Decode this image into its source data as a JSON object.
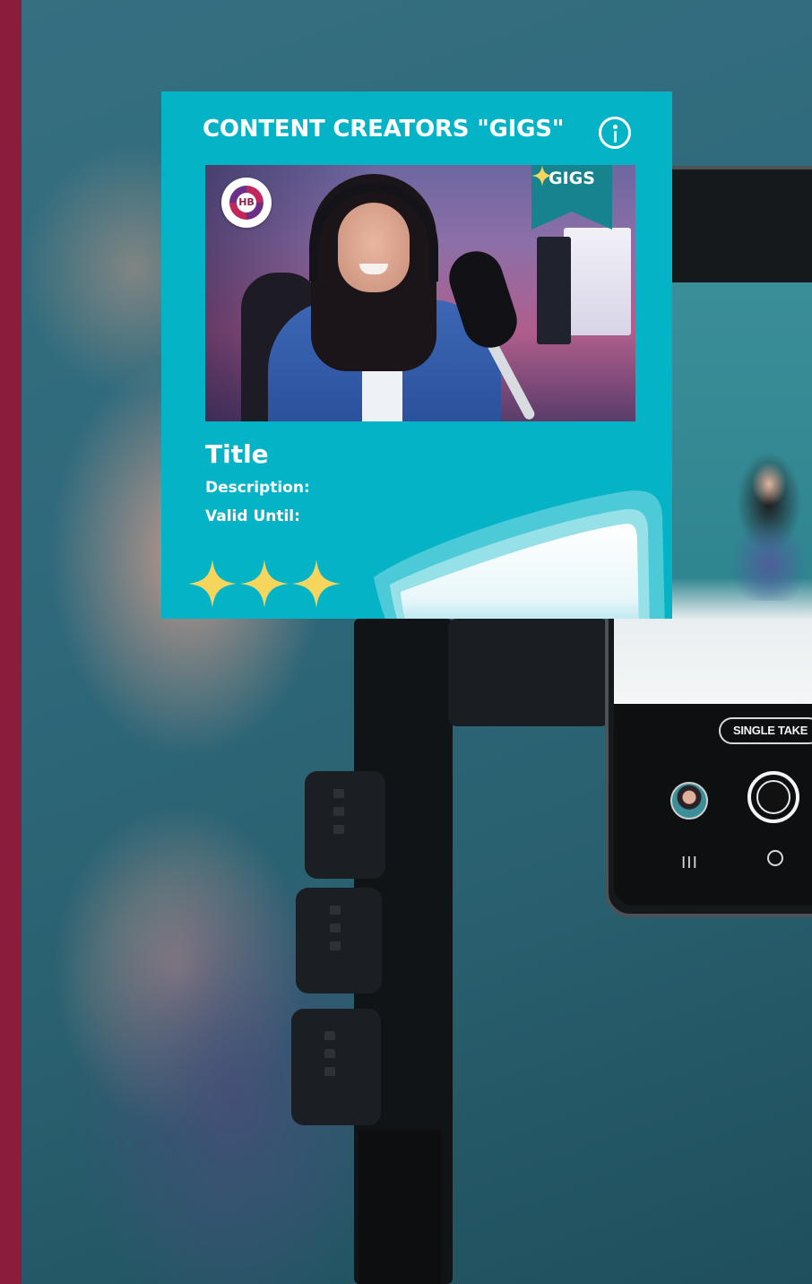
{
  "card": {
    "title": "CONTENT CREATORS \"GIGS\"",
    "badge_label": "GIGS",
    "field_title": "Title",
    "description_label": "Description:",
    "valid_until_label": "Valid Until:",
    "rating": 3,
    "logo_text": "HB"
  },
  "phone": {
    "mode_label": "SINGLE TAKE",
    "nav_recent": "III"
  },
  "colors": {
    "card_background": "#05b3c7",
    "ribbon": "#17838f",
    "star": "#f6d55c",
    "left_stripe": "#8c1c3c"
  },
  "icons": [
    "info-icon",
    "star-icon",
    "logo-badge",
    "shutter-button",
    "gallery-thumbnail",
    "nav-home-icon"
  ]
}
